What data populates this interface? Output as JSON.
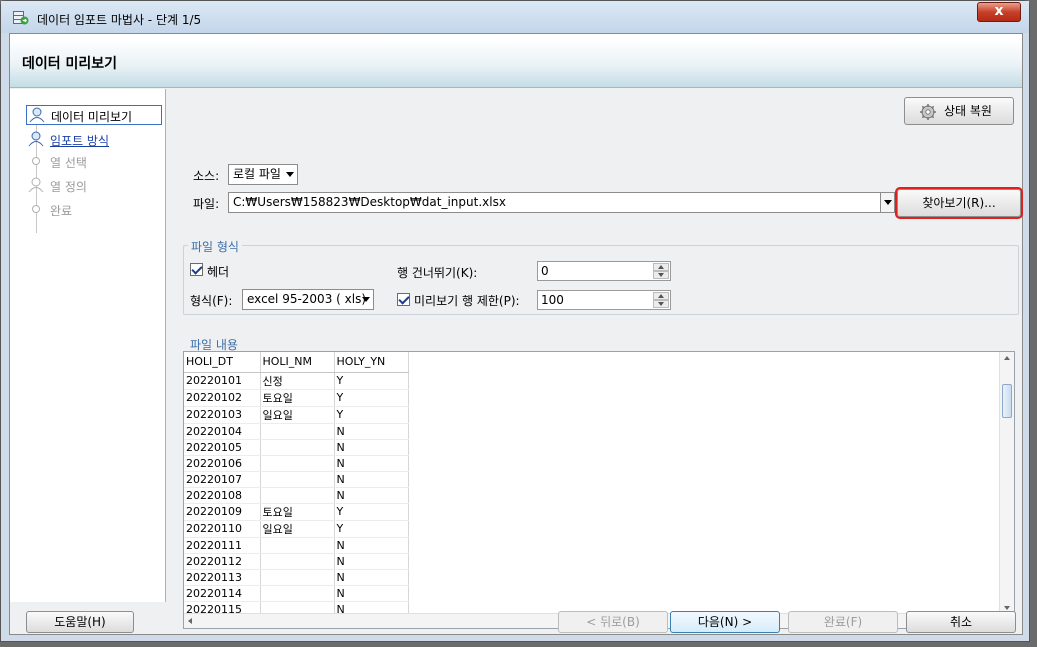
{
  "window": {
    "title": "데이터 임포트 마법사 - 단계 1/5",
    "close": "x"
  },
  "header": {
    "title": "데이터 미리보기"
  },
  "steps": [
    {
      "label": "데이터 미리보기",
      "state": "active"
    },
    {
      "label": "임포트 방식",
      "state": "link"
    },
    {
      "label": "열 선택",
      "state": "disabled"
    },
    {
      "label": "열 정의",
      "state": "disabled"
    },
    {
      "label": "완료",
      "state": "disabled"
    }
  ],
  "toolbar": {
    "restore_label": "상태 복원"
  },
  "source": {
    "label": "소스:",
    "value": "로컬 파일"
  },
  "file": {
    "label": "파일:",
    "path": "C:₩Users₩158823₩Desktop₩dat_input.xlsx",
    "browse_label": "찾아보기(R)..."
  },
  "file_format": {
    "title": "파일 형식",
    "header_label": "헤더",
    "format_label": "형식(F):",
    "format_value": "excel 95-2003 ( xls)",
    "skip_label": "행 건너뛰기(K):",
    "skip_value": "0",
    "limit_label": "미리보기 행 제한(P):",
    "limit_value": "100"
  },
  "file_contents": {
    "title": "파일 내용",
    "columns": [
      "HOLI_DT",
      "HOLI_NM",
      "HOLY_YN"
    ],
    "rows": [
      [
        "20220101",
        "신정",
        "Y"
      ],
      [
        "20220102",
        "토요일",
        "Y"
      ],
      [
        "20220103",
        "일요일",
        "Y"
      ],
      [
        "20220104",
        "",
        "N"
      ],
      [
        "20220105",
        "",
        "N"
      ],
      [
        "20220106",
        "",
        "N"
      ],
      [
        "20220107",
        "",
        "N"
      ],
      [
        "20220108",
        "",
        "N"
      ],
      [
        "20220109",
        "토요일",
        "Y"
      ],
      [
        "20220110",
        "일요일",
        "Y"
      ],
      [
        "20220111",
        "",
        "N"
      ],
      [
        "20220112",
        "",
        "N"
      ],
      [
        "20220113",
        "",
        "N"
      ],
      [
        "20220114",
        "",
        "N"
      ],
      [
        "20220115",
        "",
        "N"
      ]
    ]
  },
  "footer": {
    "help": "도움말(H)",
    "back": "< 뒤로(B)",
    "next": "다음(N) >",
    "finish": "완료(F)",
    "cancel": "취소"
  }
}
